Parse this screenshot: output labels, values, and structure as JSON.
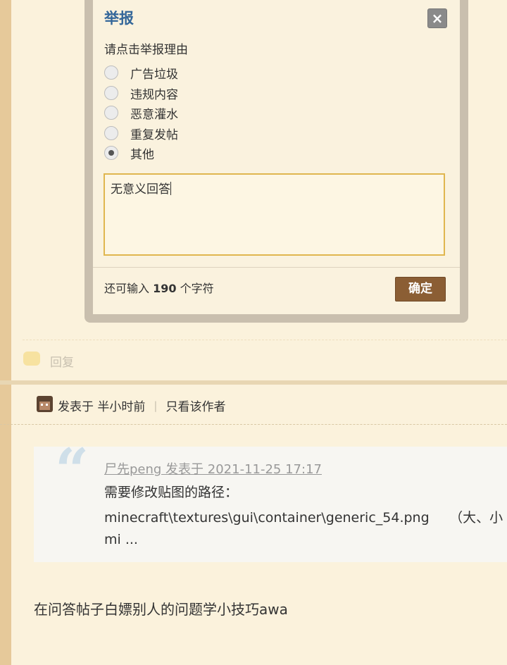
{
  "dialog": {
    "title": "举报",
    "close_icon": "×",
    "prompt": "请点击举报理由",
    "reasons": [
      {
        "label": "广告垃圾",
        "checked": false
      },
      {
        "label": "违规内容",
        "checked": false
      },
      {
        "label": "恶意灌水",
        "checked": false
      },
      {
        "label": "重复发帖",
        "checked": false
      },
      {
        "label": "其他",
        "checked": true
      }
    ],
    "textarea_value": "无意义回答",
    "remaining_prefix": "还可输入 ",
    "remaining_count": "190",
    "remaining_suffix": " 个字符",
    "confirm_label": "确定"
  },
  "reply": {
    "label": "回复",
    "icon": "speech-bubble-icon"
  },
  "post": {
    "avatar": "minecraft-steve-avatar",
    "posted": "发表于 半小时前",
    "separator": "|",
    "only_author": "只看该作者",
    "quote": {
      "mark": "“",
      "author": "尸先peng 发表于 2021-11-25 17:17",
      "line1": "需要修改贴图的路径：",
      "line2": "minecraft\\textures\\gui\\container\\generic_54.png　　（大、小",
      "line3": "mi ..."
    },
    "body": "在问答帖子白嫖别人的问题学小技巧awa"
  },
  "colors": {
    "background": "#fbf2dc",
    "title": "#336699",
    "confirm_button": "#8b5e34",
    "textarea_border": "#e0b64e"
  }
}
